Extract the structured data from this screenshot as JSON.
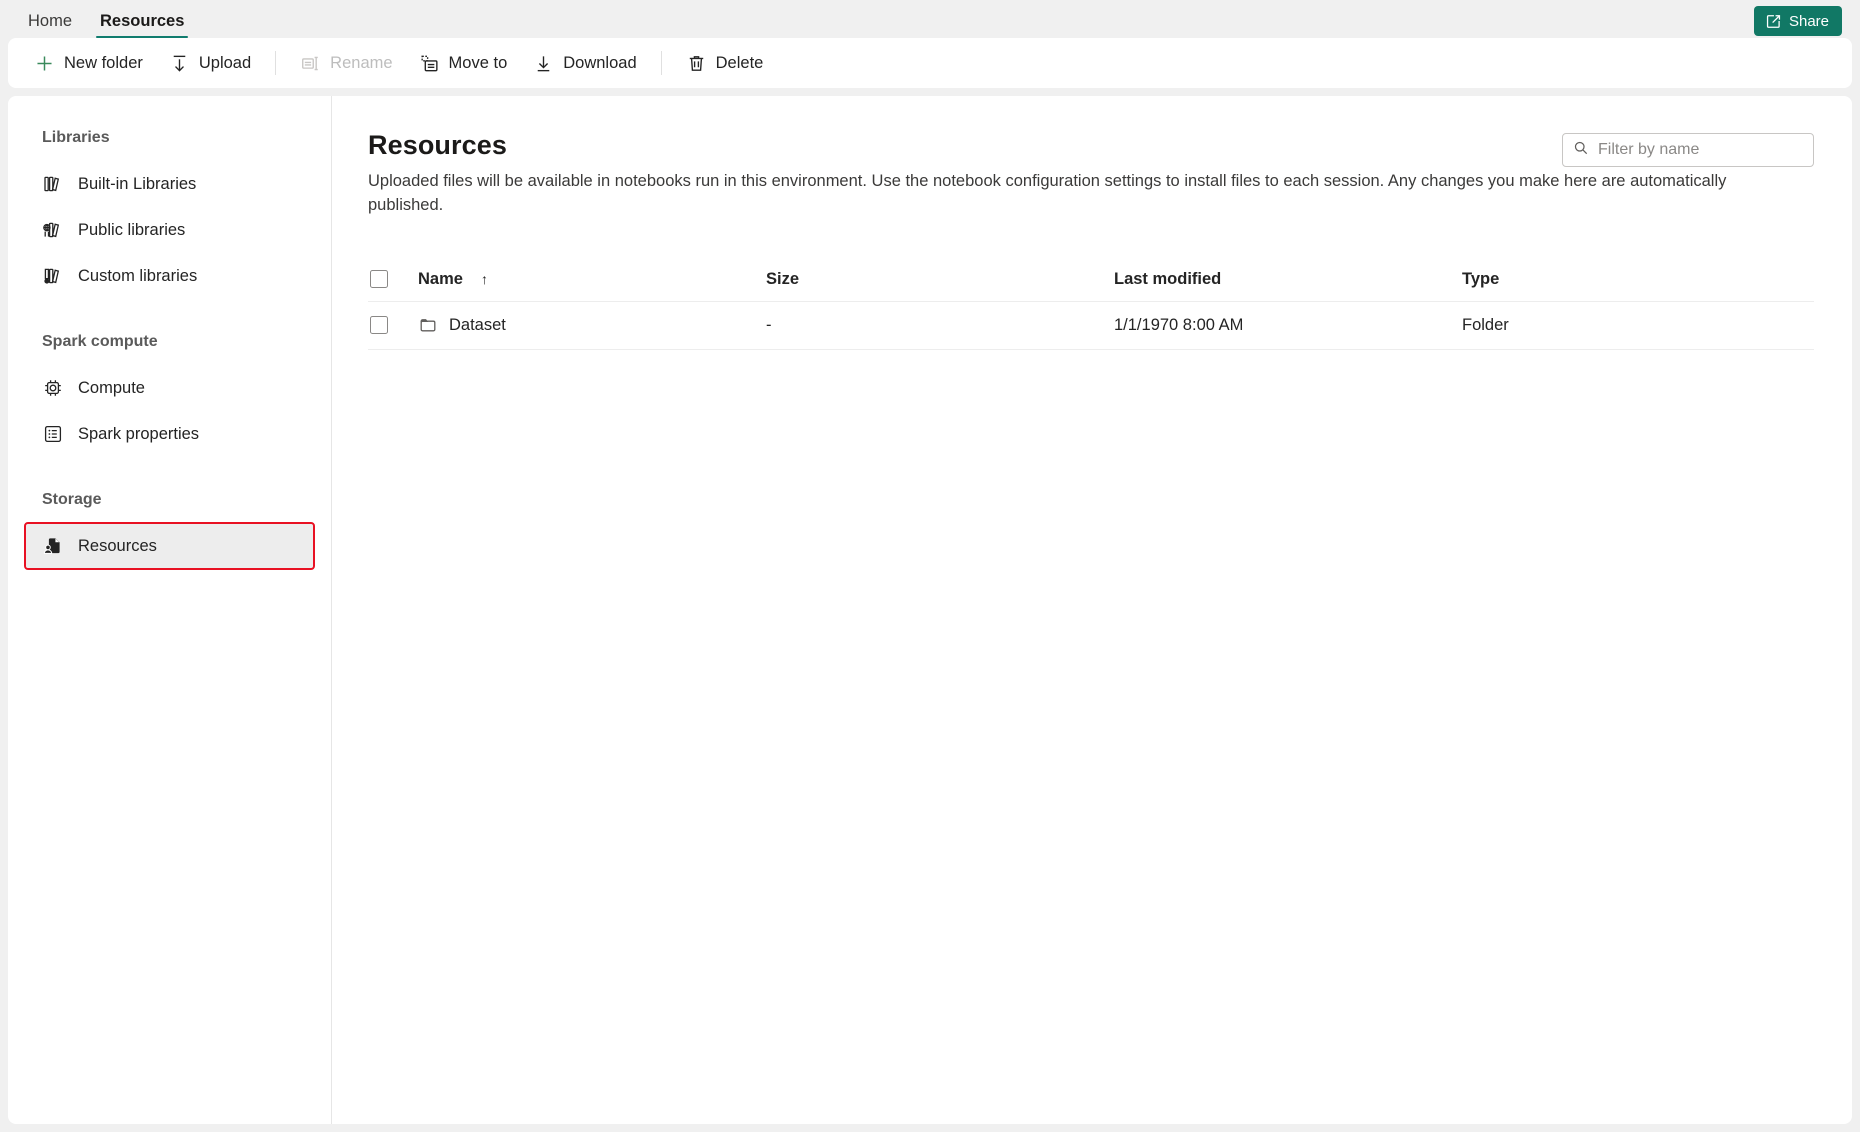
{
  "window": {
    "tabs": [
      {
        "label": "Home",
        "active": false
      },
      {
        "label": "Resources",
        "active": true
      }
    ],
    "share_label": "Share",
    "accent_color": "#117865",
    "highlight_color": "#e81123"
  },
  "toolbar": {
    "new_folder_label": "New folder",
    "upload_label": "Upload",
    "rename_label": "Rename",
    "move_to_label": "Move to",
    "download_label": "Download",
    "delete_label": "Delete"
  },
  "sidebar": {
    "groups": [
      {
        "title": "Libraries",
        "items": [
          {
            "label": "Built-in Libraries",
            "icon": "books-icon"
          },
          {
            "label": "Public libraries",
            "icon": "public-books-icon"
          },
          {
            "label": "Custom libraries",
            "icon": "custom-books-icon"
          }
        ]
      },
      {
        "title": "Spark compute",
        "items": [
          {
            "label": "Compute",
            "icon": "cpu-chip-icon"
          },
          {
            "label": "Spark properties",
            "icon": "properties-list-icon"
          }
        ]
      },
      {
        "title": "Storage",
        "items": [
          {
            "label": "Resources",
            "icon": "resources-document-person-icon"
          }
        ]
      }
    ]
  },
  "main": {
    "title": "Resources",
    "description": "Uploaded files will be available in notebooks run in this environment. Use the notebook configuration settings to install files to each session. Any changes you make here are automatically published.",
    "filter": {
      "placeholder": "Filter by name",
      "value": ""
    },
    "table": {
      "columns": {
        "name": "Name",
        "sort_indicator": "↑",
        "size": "Size",
        "last_modified": "Last modified",
        "type": "Type"
      },
      "rows": [
        {
          "name": "Dataset",
          "size": "-",
          "last_modified": "1/1/1970 8:00 AM",
          "type": "Folder",
          "icon": "folder-icon"
        }
      ]
    }
  }
}
